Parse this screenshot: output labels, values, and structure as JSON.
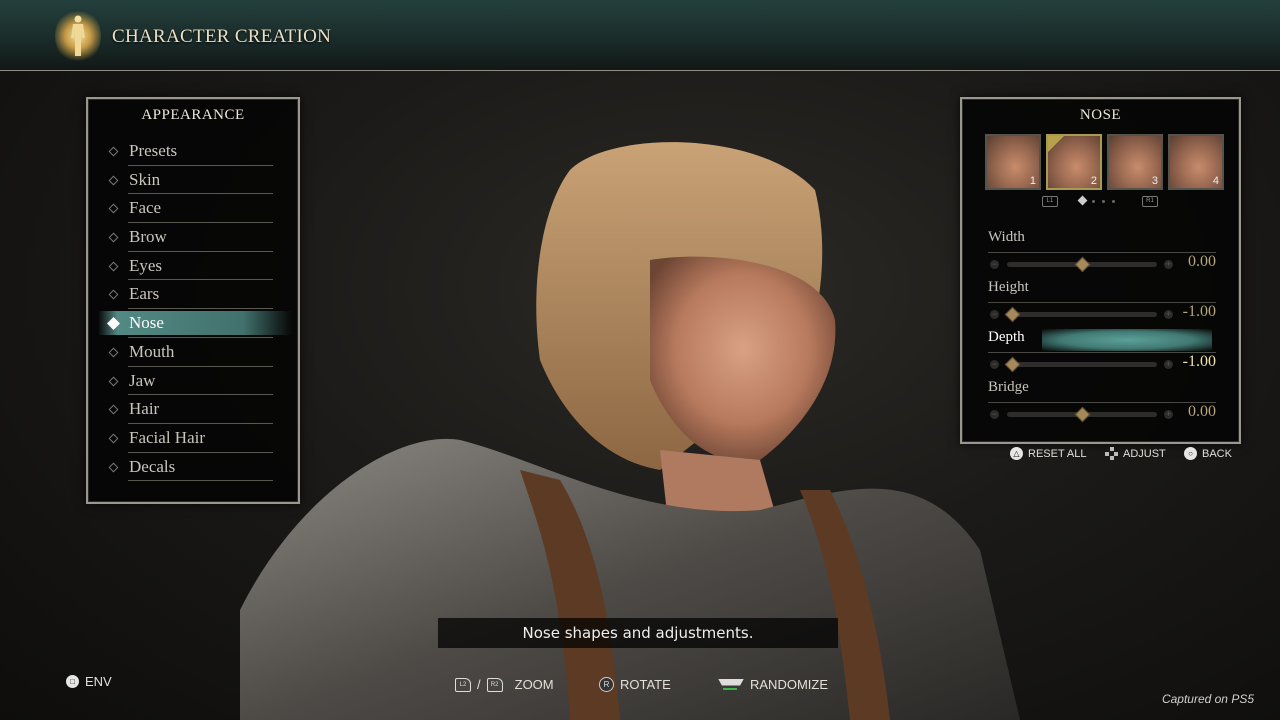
{
  "header": {
    "title": "CHARACTER CREATION",
    "icon": "character-figure-icon"
  },
  "appearance": {
    "title": "APPEARANCE",
    "items": [
      {
        "label": "Presets",
        "selected": false
      },
      {
        "label": "Skin",
        "selected": false
      },
      {
        "label": "Face",
        "selected": false
      },
      {
        "label": "Brow",
        "selected": false
      },
      {
        "label": "Eyes",
        "selected": false
      },
      {
        "label": "Ears",
        "selected": false
      },
      {
        "label": "Nose",
        "selected": true
      },
      {
        "label": "Mouth",
        "selected": false
      },
      {
        "label": "Jaw",
        "selected": false
      },
      {
        "label": "Hair",
        "selected": false
      },
      {
        "label": "Facial Hair",
        "selected": false
      },
      {
        "label": "Decals",
        "selected": false
      }
    ]
  },
  "nose": {
    "title": "NOSE",
    "presets": [
      {
        "num": "1",
        "selected": false
      },
      {
        "num": "2",
        "selected": true
      },
      {
        "num": "3",
        "selected": false
      },
      {
        "num": "4",
        "selected": false
      }
    ],
    "pager": {
      "prev": "L1",
      "next": "R1",
      "page": 1,
      "pages": 4
    },
    "sliders": [
      {
        "label": "Width",
        "value": "0.00",
        "fraction": 0.5,
        "selected": false
      },
      {
        "label": "Height",
        "value": "-1.00",
        "fraction": 0.0,
        "selected": false
      },
      {
        "label": "Depth",
        "value": "-1.00",
        "fraction": 0.0,
        "selected": true
      },
      {
        "label": "Bridge",
        "value": "0.00",
        "fraction": 0.5,
        "selected": false
      }
    ],
    "hints": {
      "reset_all": "RESET ALL",
      "adjust": "ADJUST",
      "back": "BACK"
    }
  },
  "caption": "Nose shapes and adjustments.",
  "bottom": {
    "env": "ENV",
    "zoom": "ZOOM",
    "zoom_buttons": [
      "L2",
      "R2"
    ],
    "zoom_sep": "/",
    "rotate": "ROTATE",
    "rotate_button": "R",
    "randomize": "RANDOMIZE"
  },
  "watermark": "Captured on PS5",
  "colors": {
    "accent": "#5fa39b",
    "gold": "#b8a57c",
    "preset_selected": "#a99a52"
  }
}
